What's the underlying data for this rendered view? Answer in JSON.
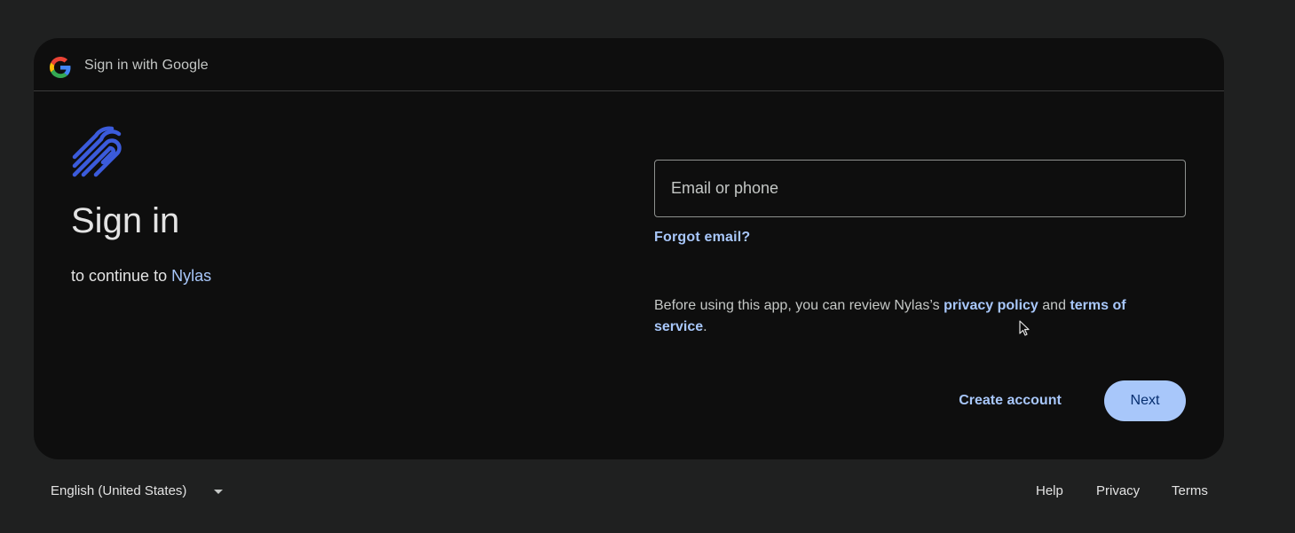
{
  "header": {
    "title": "Sign in with Google",
    "logo_icon": "google-g-icon"
  },
  "main": {
    "app_logo_icon": "nylas-logo-icon",
    "heading": "Sign in",
    "subtitle_prefix": "to continue to",
    "app_name": "Nylas"
  },
  "form": {
    "email_placeholder": "Email or phone",
    "email_value": "",
    "forgot_email": "Forgot email?"
  },
  "notice": {
    "text_before": "Before using this app, you can review Nylas’s",
    "privacy_link": "privacy policy",
    "and_text": "and",
    "terms_link": "terms of service",
    "period": "."
  },
  "actions": {
    "create_account": "Create account",
    "next": "Next"
  },
  "footer": {
    "language": "English (United States)",
    "help": "Help",
    "privacy": "Privacy",
    "terms": "Terms"
  },
  "colors": {
    "page_bg": "#1f2020",
    "card_bg": "#0e0e0e",
    "accent": "#a8c7fa",
    "next_text": "#062e6f",
    "brand_logo": "#3b5bdb"
  }
}
